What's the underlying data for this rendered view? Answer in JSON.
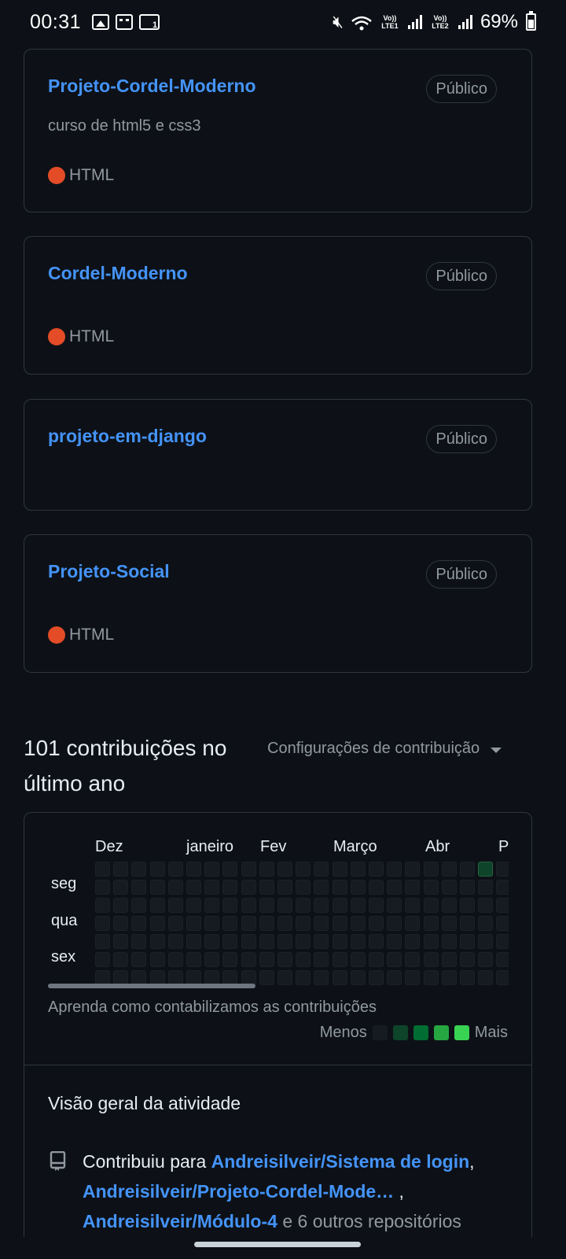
{
  "status_bar": {
    "time": "00:31",
    "battery": "69%",
    "net1": "Vo)) LTE1",
    "net2": "Vo)) LTE2"
  },
  "repos": [
    {
      "name": "Projeto-Cordel-Moderno",
      "visibility": "Público",
      "description": "curso de html5 e css3",
      "language": "HTML",
      "language_color": "#e34c26"
    },
    {
      "name": "Cordel-Moderno",
      "visibility": "Público",
      "description": "",
      "language": "HTML",
      "language_color": "#e34c26"
    },
    {
      "name": "projeto-em-django",
      "visibility": "Público",
      "description": "",
      "language": "",
      "language_color": ""
    },
    {
      "name": "Projeto-Social",
      "visibility": "Público",
      "description": "",
      "language": "HTML",
      "language_color": "#e34c26"
    }
  ],
  "contributions": {
    "title": "101 contribuições no último ano",
    "settings_label": "Configurações de contribuição",
    "months": [
      "Dez",
      "janeiro",
      "Fev",
      "Março",
      "Abr",
      "P"
    ],
    "days": [
      "seg",
      "qua",
      "sex"
    ],
    "learn_link": "Aprenda como contabilizamos as contribuições",
    "legend_less": "Menos",
    "legend_more": "Mais",
    "legend_colors": [
      "#161b22",
      "#0e4429",
      "#006d32",
      "#26a641",
      "#39d353"
    ]
  },
  "activity": {
    "title": "Visão geral da atividade",
    "prefix": "Contribuiu para",
    "repo1": "Andreisilveir/Sistema de login",
    "repo2": "Andreisilveir/Projeto-Cordel-Mode…",
    "repo3": "Andreisilveir/Módulo-4",
    "suffix": "e 6 outros repositórios"
  }
}
